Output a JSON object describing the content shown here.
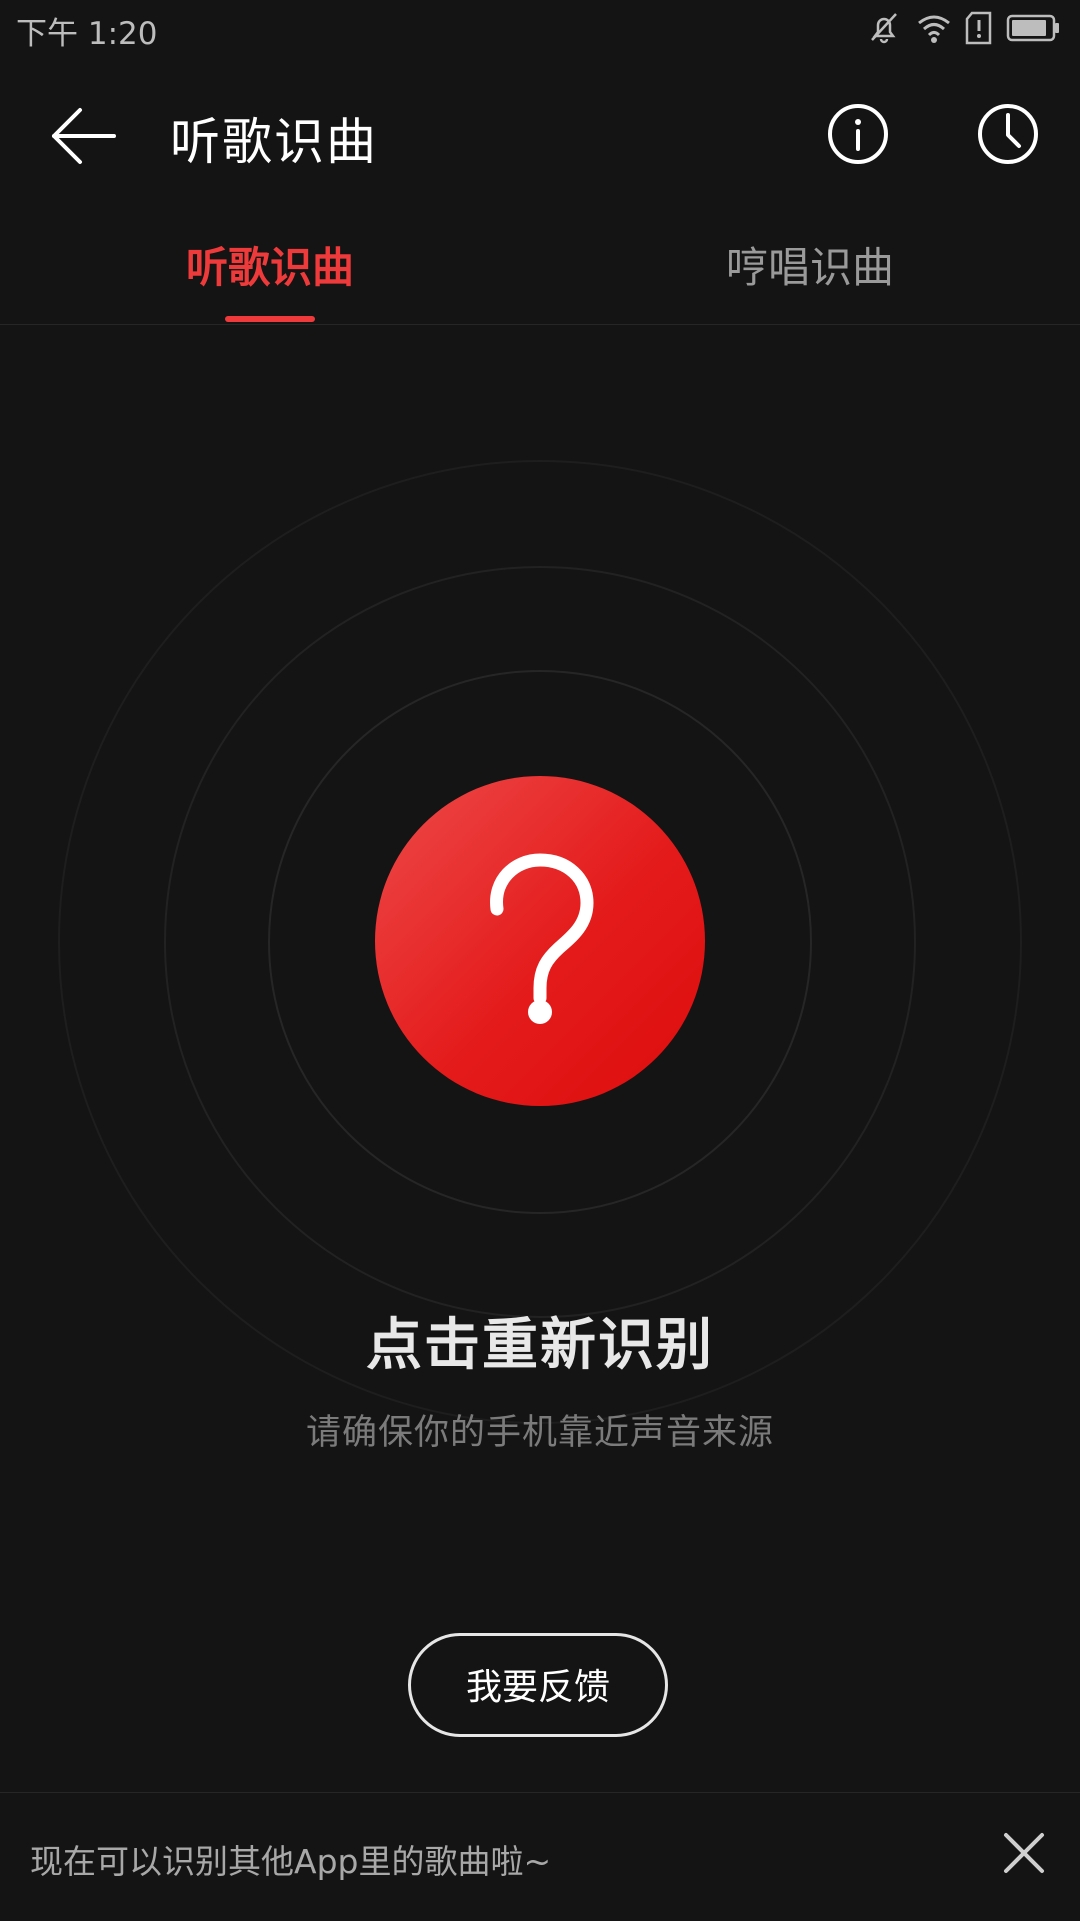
{
  "status_bar": {
    "time": "下午 1:20",
    "icons": [
      "bell-muted-icon",
      "wifi-icon",
      "sim-alert-icon",
      "battery-icon"
    ]
  },
  "header": {
    "title": "听歌识曲",
    "icons": [
      "back-arrow-icon",
      "info-icon",
      "history-clock-icon"
    ]
  },
  "tabs": [
    {
      "label": "听歌识曲",
      "active": true
    },
    {
      "label": "哼唱识曲",
      "active": false
    }
  ],
  "main": {
    "button_icon": "question-mark-icon",
    "title": "点击重新识别",
    "subtitle": "请确保你的手机靠近声音来源",
    "feedback_label": "我要反馈"
  },
  "banner": {
    "text": "现在可以识别其他App里的歌曲啦~",
    "close_icon": "close-icon"
  },
  "colors": {
    "background": "#141414",
    "accent": "#ee3a3a",
    "button_red": "#e41b1b"
  }
}
